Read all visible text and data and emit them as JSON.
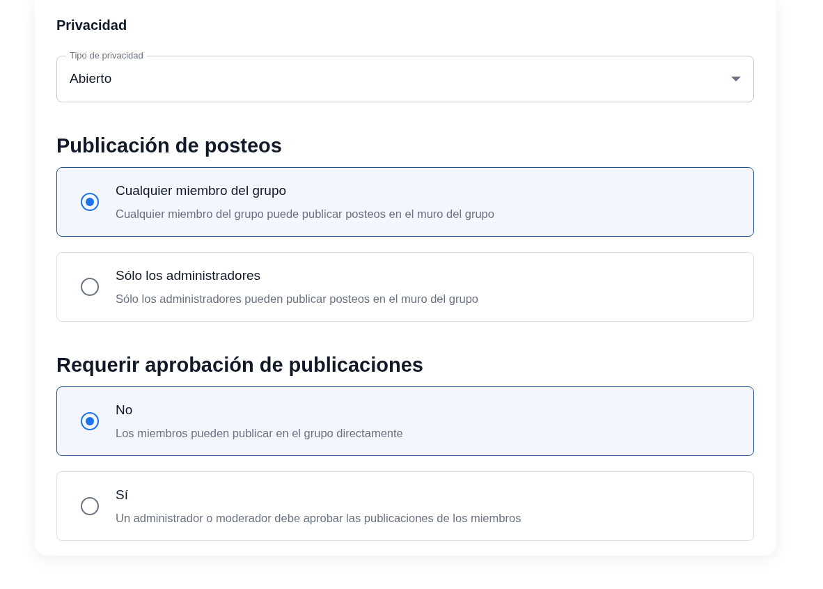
{
  "sections": [
    {
      "kind": "select",
      "heading": "Privacidad",
      "field": {
        "label": "Tipo de privacidad",
        "value": "Abierto"
      }
    },
    {
      "kind": "radio",
      "heading": "Publicación de posteos",
      "options": [
        {
          "title": "Cualquier miembro del grupo",
          "description": "Cualquier miembro del grupo puede publicar posteos en el muro del grupo",
          "selected": true
        },
        {
          "title": "Sólo los administradores",
          "description": "Sólo los administradores pueden publicar posteos en el muro del grupo",
          "selected": false
        }
      ]
    },
    {
      "kind": "radio",
      "heading": "Requerir aprobación de publicaciones",
      "options": [
        {
          "title": "No",
          "description": "Los miembros pueden publicar en el grupo directamente",
          "selected": true
        },
        {
          "title": "Sí",
          "description": "Un administrador o moderador debe aprobar las publicaciones de los miembros",
          "selected": false
        }
      ]
    }
  ]
}
